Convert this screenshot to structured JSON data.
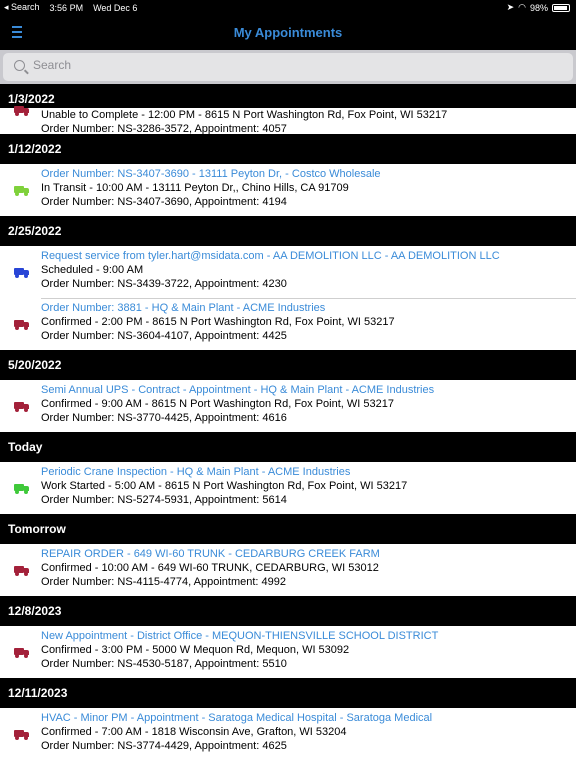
{
  "status_bar": {
    "back_label": "◂ Search",
    "time": "3:56 PM",
    "date": "Wed Dec 6",
    "battery": "98%"
  },
  "nav": {
    "title": "My Appointments",
    "menu_icon": "menu-icon"
  },
  "search": {
    "placeholder": "Search",
    "value": ""
  },
  "colors": {
    "accent": "#3a8bd8",
    "truck_red": "#a3213a",
    "truck_green": "#7fd13b",
    "truck_blue": "#2845d6",
    "truck_bright_green": "#3fc93a"
  },
  "sections": [
    {
      "header": "1/3/2022",
      "rows": [
        {
          "clipped": true,
          "color": "#a3213a",
          "title": "",
          "status": "Unable to Complete - 12:00 PM - 8615 N Port Washington Rd, Fox Point, WI 53217",
          "order": "Order Number: NS-3286-3572, Appointment: 4057"
        }
      ]
    },
    {
      "header": "1/12/2022",
      "rows": [
        {
          "color": "#7fd13b",
          "title": "Order Number: NS-3407-3690 - 13111 Peyton Dr, - Costco Wholesale",
          "status": "In Transit - 10:00 AM - 13111 Peyton Dr,, Chino Hills, CA 91709",
          "order": "Order Number: NS-3407-3690, Appointment: 4194"
        }
      ]
    },
    {
      "header": "2/25/2022",
      "rows": [
        {
          "color": "#2845d6",
          "title": "Request service from tyler.hart@msidata.com - AA DEMOLITION LLC - AA DEMOLITION LLC",
          "status": "Scheduled - 9:00 AM",
          "order": "Order Number: NS-3439-3722, Appointment: 4230"
        },
        {
          "color": "#a3213a",
          "title": "Order Number: 3881 - HQ & Main Plant - ACME Industries",
          "status": "Confirmed - 2:00 PM - 8615 N Port Washington Rd, Fox Point, WI 53217",
          "order": "Order Number: NS-3604-4107, Appointment: 4425"
        }
      ]
    },
    {
      "header": "5/20/2022",
      "rows": [
        {
          "color": "#a3213a",
          "title": "Semi Annual UPS - Contract - Appointment - HQ & Main Plant - ACME Industries",
          "status": "Confirmed - 9:00 AM - 8615 N Port Washington Rd, Fox Point, WI 53217",
          "order": "Order Number: NS-3770-4425, Appointment: 4616"
        }
      ]
    },
    {
      "header": "Today",
      "rows": [
        {
          "color": "#3fc93a",
          "title": "Periodic Crane Inspection - HQ & Main Plant - ACME Industries",
          "status": "Work Started - 5:00 AM - 8615 N Port Washington Rd, Fox Point, WI 53217",
          "order": "Order Number: NS-5274-5931, Appointment: 5614"
        }
      ]
    },
    {
      "header": "Tomorrow",
      "rows": [
        {
          "color": "#a3213a",
          "title": "REPAIR ORDER  - 649 WI-60 TRUNK - CEDARBURG CREEK FARM",
          "status": "Confirmed - 10:00 AM - 649 WI-60 TRUNK, CEDARBURG, WI 53012",
          "order": "Order Number: NS-4115-4774, Appointment: 4992"
        }
      ]
    },
    {
      "header": "12/8/2023",
      "rows": [
        {
          "color": "#a3213a",
          "title": "New Appointment - District Office - MEQUON-THIENSVILLE SCHOOL DISTRICT",
          "status": "Confirmed - 3:00 PM - 5000 W Mequon Rd, Mequon, WI 53092",
          "order": "Order Number: NS-4530-5187, Appointment: 5510"
        }
      ]
    },
    {
      "header": "12/11/2023",
      "rows": [
        {
          "color": "#a3213a",
          "title": "HVAC - Minor PM - Appointment - Saratoga Medical Hospital - Saratoga Medical",
          "status": "Confirmed - 7:00 AM - 1818 Wisconsin Ave, Grafton, WI 53204",
          "order": "Order Number: NS-3774-4429, Appointment: 4625"
        }
      ]
    }
  ]
}
